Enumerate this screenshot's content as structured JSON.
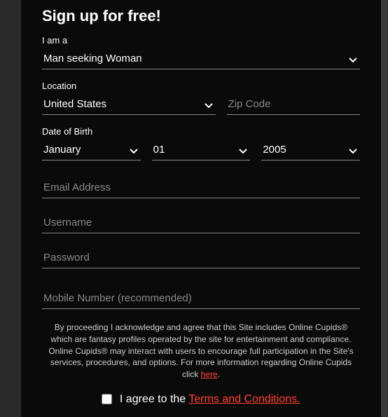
{
  "title": "Sign up for free!",
  "labels": {
    "iam": "I am a",
    "location": "Location",
    "dob": "Date of Birth"
  },
  "seeking": {
    "value": "Man seeking Woman"
  },
  "location": {
    "country": "United States",
    "zip_placeholder": "Zip Code"
  },
  "dob": {
    "month": "January",
    "day": "01",
    "year": "2005"
  },
  "placeholders": {
    "email": "Email Address",
    "username": "Username",
    "password": "Password",
    "mobile": "Mobile Number (recommended)"
  },
  "disclaimer": {
    "text_before": "By proceeding I acknowledge and agree that this Site includes Online Cupids® which are fantasy profiles operated by the site for entertainment and compliance. Online Cupids® may interact with users to encourage full participation in the Site's services, procedures, and options. For more information regarding Online Cupids click ",
    "link": "here",
    "text_after": "."
  },
  "agree": {
    "text": "I agree to the ",
    "link": "Terms and Conditions."
  }
}
